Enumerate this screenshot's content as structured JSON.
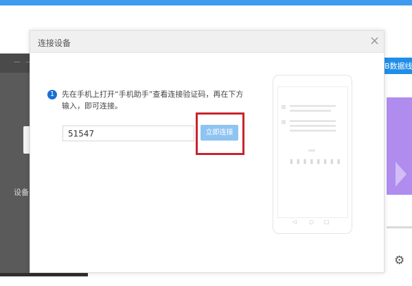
{
  "app": {
    "left_panel_dots": "— —",
    "left_label": "设备",
    "right_tab_label": "B数据线",
    "settings_icon": "gear-icon"
  },
  "dialog": {
    "title": "连接设备",
    "close_icon": "×",
    "step_number": "1",
    "instruction": "先在手机上打开“手机助手”查看连接验证码，再在下方输入，即可连接。",
    "code_value": "51547",
    "connect_button": "立即连接"
  },
  "colors": {
    "accent": "#3d9cf0",
    "button": "#8fc4f2",
    "highlight": "#c8232c",
    "step_badge": "#1a6fd1"
  }
}
